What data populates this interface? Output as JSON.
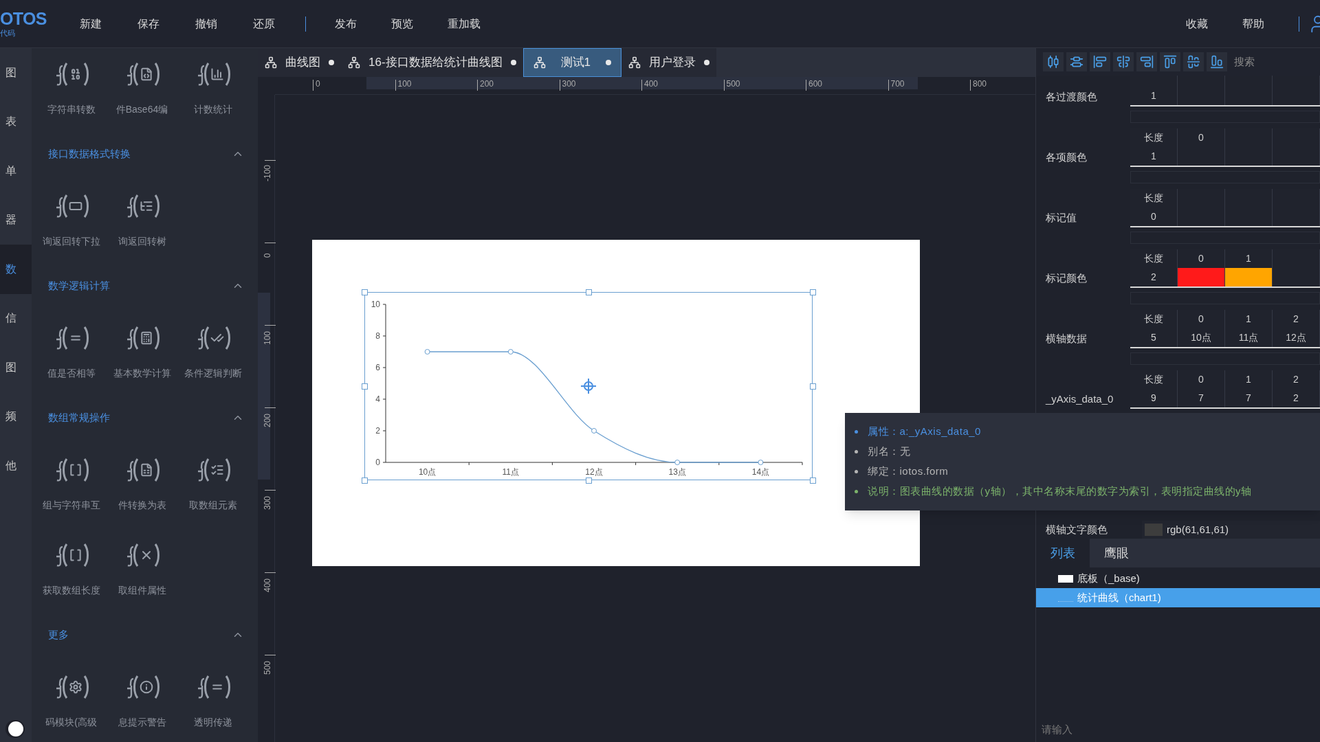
{
  "top_bar": {
    "logo": "OTOS",
    "logo_subtitle": "代码",
    "menu": [
      "新建",
      "保存",
      "撤销",
      "还原"
    ],
    "menu_2": [
      "发布",
      "预览",
      "重加载"
    ],
    "right_menu": [
      "收藏",
      "帮助"
    ]
  },
  "categories": [
    {
      "label": "图",
      "selected": false
    },
    {
      "label": "表",
      "selected": false
    },
    {
      "label": "单",
      "selected": false
    },
    {
      "label": "器",
      "selected": false
    },
    {
      "label": "数",
      "selected": true
    },
    {
      "label": "信",
      "selected": false
    },
    {
      "label": "图",
      "selected": false
    },
    {
      "label": "频",
      "selected": false
    },
    {
      "label": "他",
      "selected": false
    }
  ],
  "toggle": {
    "on": true
  },
  "function_top_items": [
    {
      "label": "字符串转数"
    },
    {
      "label": "件Base64编"
    },
    {
      "label": "计数统计"
    }
  ],
  "function_sections": [
    {
      "title": "接口数据格式转换",
      "expanded": true,
      "items": [
        {
          "label": "询返回转下拉"
        },
        {
          "label": "询返回转树"
        }
      ]
    },
    {
      "title": "数学逻辑计算",
      "expanded": true,
      "items": [
        {
          "label": "值是否相等"
        },
        {
          "label": "基本数学计算"
        },
        {
          "label": "条件逻辑判断"
        }
      ]
    },
    {
      "title": "数组常规操作",
      "expanded": true,
      "items": [
        {
          "label": "组与字符串互"
        },
        {
          "label": "件转换为表"
        },
        {
          "label": "取数组元素"
        },
        {
          "label": "获取数组长度"
        },
        {
          "label": "取组件属性"
        }
      ]
    },
    {
      "title": "更多",
      "expanded": true,
      "items": [
        {
          "label": "码模块(高级"
        },
        {
          "label": "息提示警告"
        },
        {
          "label": "透明传递"
        }
      ]
    }
  ],
  "tabs": [
    {
      "label": "曲线图",
      "selected": false
    },
    {
      "label": "16-接口数据给统计曲线图",
      "selected": false
    },
    {
      "label": "测试1",
      "selected": true
    },
    {
      "label": "用户登录",
      "selected": false
    }
  ],
  "ruler": {
    "x_labels": [
      "0",
      "100",
      "200",
      "300",
      "400",
      "500",
      "600",
      "700",
      "800"
    ],
    "y_labels": [
      "-100",
      "0",
      "100",
      "200",
      "300",
      "400",
      "500"
    ]
  },
  "canvas": {
    "chart_data": {
      "type": "line",
      "categories": [
        "10点",
        "11点",
        "12点",
        "13点",
        "14点"
      ],
      "series": [
        {
          "color": "#6a9fd0",
          "marker": true,
          "values": [
            7,
            7,
            2,
            0,
            0
          ]
        }
      ],
      "ylim": [
        0,
        10
      ],
      "yticks": [
        0,
        2,
        4,
        6,
        8,
        10
      ]
    }
  },
  "toolbar": {
    "search_placeholder": "搜索"
  },
  "properties": [
    {
      "label": "各过渡颜色",
      "kind": "array",
      "length": "1"
    },
    {
      "label": "各项颜色",
      "kind": "array",
      "length_label": "长度",
      "length": "1",
      "indices": [
        "0"
      ]
    },
    {
      "label": "标记值",
      "kind": "array",
      "length_label": "长度",
      "length": "0"
    },
    {
      "label": "标记颜色",
      "kind": "color_array",
      "length_label": "长度",
      "length": "2",
      "indices": [
        "0",
        "1"
      ],
      "swatches": [
        {
          "color": "#ff1a1a"
        },
        {
          "color": "#ffa500"
        }
      ]
    },
    {
      "label": "横轴数据",
      "kind": "array",
      "length_label": "长度",
      "length": "5",
      "indices": [
        "0",
        "1",
        "2"
      ],
      "values": [
        "10点",
        "11点",
        "12点"
      ]
    },
    {
      "label": "_yAxis_data_0",
      "kind": "array",
      "length_label": "长度",
      "length": "9",
      "indices": [
        "0",
        "1",
        "2"
      ],
      "values": [
        "7",
        "7",
        "2"
      ]
    }
  ],
  "axis_text_color": {
    "label": "横轴文字颜色",
    "color": "#3d3d3d",
    "value": "rgb(61,61,61)"
  },
  "layer_tabs": [
    {
      "label": "列表",
      "selected": true
    },
    {
      "label": "鹰眼",
      "selected": false
    }
  ],
  "layers": [
    {
      "label": "底板（_base)",
      "kind": "base",
      "selected": false
    },
    {
      "label": "统计曲线（chart1)",
      "kind": "chart",
      "selected": true
    }
  ],
  "layer_filter": {
    "placeholder": "请输入"
  },
  "tooltip": {
    "items": [
      {
        "text": "属性：a:_yAxis_data_0",
        "color": "#4a8fe0"
      },
      {
        "text": "别名：无",
        "color": "#b4b4b4"
      },
      {
        "text": "绑定：iotos.form",
        "color": "#b4b4b4"
      },
      {
        "text": "说明：图表曲线的数据（y轴），其中名称末尾的数字为索引，表明指定曲线的y轴",
        "color": "#7cb36b"
      }
    ]
  }
}
